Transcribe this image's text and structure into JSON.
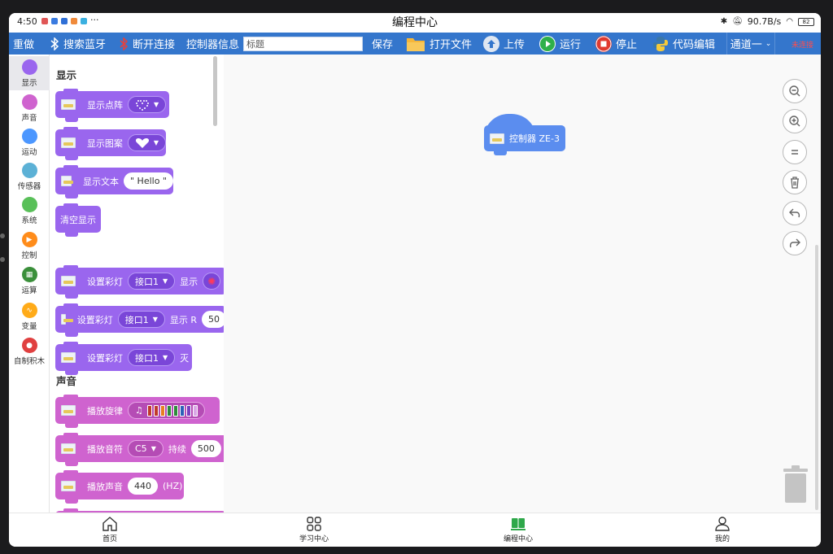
{
  "status": {
    "time": "4:50",
    "more": "···",
    "title": "编程中心",
    "net_speed": "90.7B/s",
    "battery": "82"
  },
  "toolbar": {
    "redo": "重做",
    "search_bt": "搜索蓝牙",
    "disconnect": "断开连接",
    "controller_info": "控制器信息",
    "title_placeholder": "标题",
    "save": "保存",
    "open_file": "打开文件",
    "upload": "上传",
    "run": "运行",
    "stop": "停止",
    "code_edit": "代码编辑",
    "channel": "通道一",
    "conn_status": "未连接"
  },
  "categories": [
    {
      "label": "显示",
      "color": "#9a66ee",
      "icon": "circle"
    },
    {
      "label": "声音",
      "color": "#cf63cf",
      "icon": "circle"
    },
    {
      "label": "运动",
      "color": "#4c97ff",
      "icon": "circle"
    },
    {
      "label": "传感器",
      "color": "#5cb1d6",
      "icon": "circle"
    },
    {
      "label": "系统",
      "color": "#59c059",
      "icon": "circle"
    },
    {
      "label": "控制",
      "color": "#ff8c1a",
      "icon": "play-icon"
    },
    {
      "label": "运算",
      "color": "#3a8f3a",
      "icon": "grid-icon"
    },
    {
      "label": "变量",
      "color": "#ffab19",
      "icon": "wave-icon"
    },
    {
      "label": "自制积木",
      "color": "#e04040",
      "icon": "person-icon"
    }
  ],
  "palette": {
    "display_title": "显示",
    "sound_title": "声音",
    "show_matrix": "显示点阵",
    "show_pattern": "显示图案",
    "show_text": "显示文本",
    "text_value": "\" Hello \"",
    "clear_display": "清空显示",
    "set_led": "设置彩灯",
    "port1": "接口1",
    "show": "显示",
    "show_r": "显示 R",
    "r_value": "50",
    "off": "灭",
    "play_melody": "播放旋律",
    "play_note": "播放音符",
    "note_value": "C5",
    "duration": "持续",
    "duration_value": "500",
    "play_sound": "播放声音",
    "freq_value": "440",
    "hz": "(HZ)"
  },
  "canvas": {
    "hat_label": "控制器 ZE-3"
  },
  "nav": {
    "home": "首页",
    "learning": "学习中心",
    "coding": "编程中心",
    "mine": "我的"
  },
  "colors": {
    "toolbar": "#3476cc",
    "display_blocks": "#9a66ee",
    "sound_blocks": "#cf63cf",
    "hat_block": "#5b8def",
    "active_nav": "#2ea84a",
    "disconnected": "#ff4d4d"
  }
}
